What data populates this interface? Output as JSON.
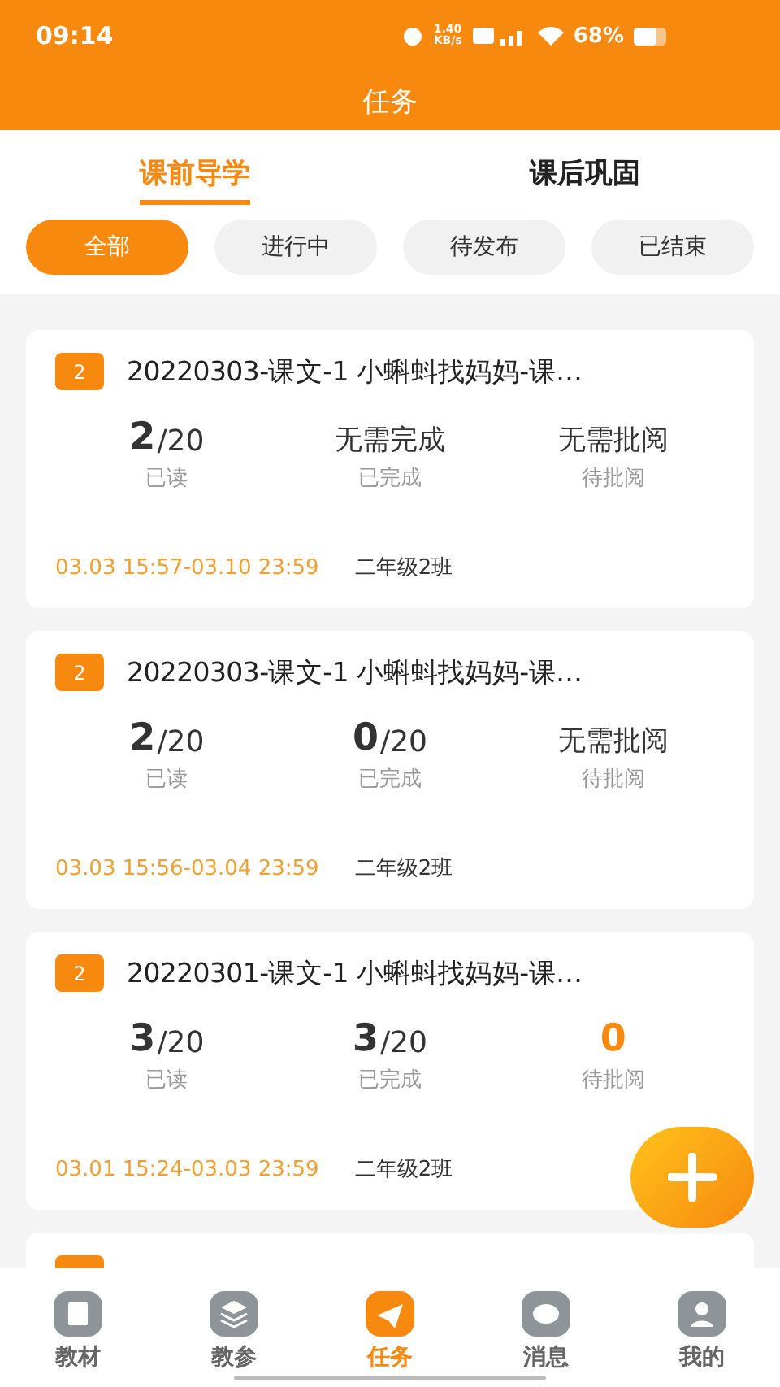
{
  "status_bar": {
    "time": "09:14",
    "speed": "1.40 KB/s",
    "battery": "68%"
  },
  "header": {
    "title": "任务"
  },
  "tabs": [
    {
      "label": "课前导学",
      "selected": true
    },
    {
      "label": "课后巩固",
      "selected": false
    }
  ],
  "filters": [
    {
      "label": "全部",
      "selected": true
    },
    {
      "label": "进行中",
      "selected": false
    },
    {
      "label": "待发布",
      "selected": false
    },
    {
      "label": "已结束",
      "selected": false
    }
  ],
  "tasks": [
    {
      "badge": "2",
      "title": "20220303-课文-1 小蝌蚪找妈妈-课…",
      "stats": [
        {
          "kind": "count",
          "value": "2",
          "total": "/20",
          "label": "已读",
          "highlight": false
        },
        {
          "kind": "text",
          "value": "无需完成",
          "label": "已完成",
          "highlight": false
        },
        {
          "kind": "text",
          "value": "无需批阅",
          "label": "待批阅",
          "highlight": false
        }
      ],
      "period": "03.03 15:57-03.10 23:59",
      "class_name": "二年级2班"
    },
    {
      "badge": "2",
      "title": "20220303-课文-1 小蝌蚪找妈妈-课…",
      "stats": [
        {
          "kind": "count",
          "value": "2",
          "total": "/20",
          "label": "已读",
          "highlight": false
        },
        {
          "kind": "count",
          "value": "0",
          "total": "/20",
          "label": "已完成",
          "highlight": false
        },
        {
          "kind": "text",
          "value": "无需批阅",
          "label": "待批阅",
          "highlight": false
        }
      ],
      "period": "03.03 15:56-03.04 23:59",
      "class_name": "二年级2班"
    },
    {
      "badge": "2",
      "title": "20220301-课文-1 小蝌蚪找妈妈-课…",
      "stats": [
        {
          "kind": "count",
          "value": "3",
          "total": "/20",
          "label": "已读",
          "highlight": false
        },
        {
          "kind": "count",
          "value": "3",
          "total": "/20",
          "label": "已完成",
          "highlight": false
        },
        {
          "kind": "count",
          "value": "0",
          "label": "待批阅",
          "highlight": true
        }
      ],
      "period": "03.01 15:24-03.03 23:59",
      "class_name": "二年级2班"
    }
  ],
  "nav": [
    {
      "label": "教材",
      "selected": false
    },
    {
      "label": "教参",
      "selected": false
    },
    {
      "label": "任务",
      "selected": true
    },
    {
      "label": "消息",
      "selected": false
    },
    {
      "label": "我的",
      "selected": false
    }
  ]
}
